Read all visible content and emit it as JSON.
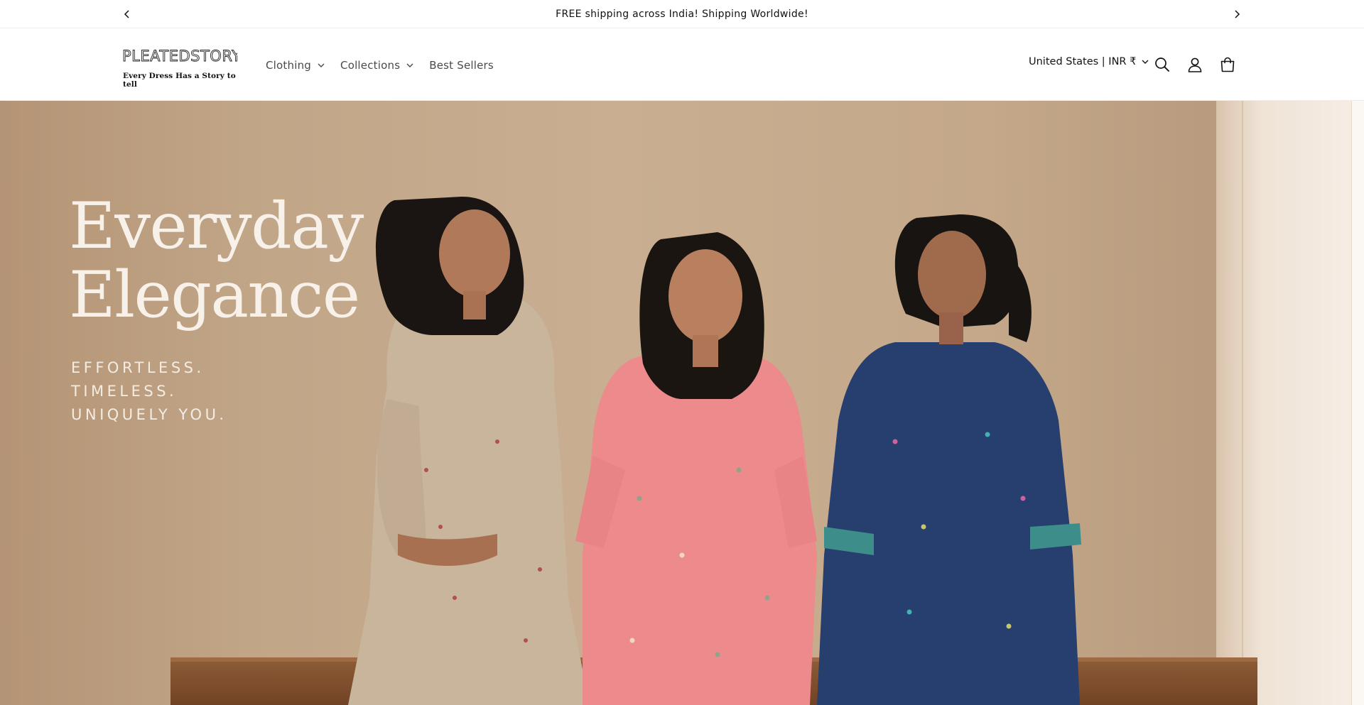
{
  "announcement": {
    "text": "FREE shipping across India! Shipping Worldwide!",
    "prev_icon": "chevron-left-icon",
    "next_icon": "chevron-right-icon"
  },
  "header": {
    "logo_text": "PLEATEDSTORY",
    "logo_tagline": "Every Dress Has a Story to tell",
    "nav": [
      {
        "label": "Clothing",
        "has_dropdown": true
      },
      {
        "label": "Collections",
        "has_dropdown": true
      },
      {
        "label": "Best Sellers",
        "has_dropdown": false
      }
    ],
    "localization": "United States | INR ₹",
    "icons": [
      "search-icon",
      "account-icon",
      "cart-icon"
    ]
  },
  "hero": {
    "title_line1": "Everyday",
    "title_line2": "Elegance",
    "subtitle_line1": "EFFORTLESS.",
    "subtitle_line2": "TIMELESS.",
    "subtitle_line3": "UNIQUELY YOU."
  },
  "colors": {
    "hero_bg": "#c4a889",
    "hero_text": "#f7f1e9",
    "dress_beige": "#c9b49c",
    "dress_pink": "#ec8a8c",
    "dress_navy": "#263f6e",
    "bench": "#7a4a2a"
  }
}
